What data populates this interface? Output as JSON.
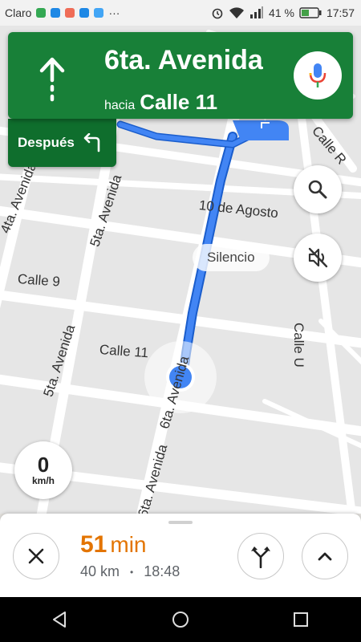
{
  "status_bar": {
    "carrier": "Claro",
    "more": "···",
    "battery_percent": "41 %",
    "time": "17:57",
    "icons": [
      "maps-icon",
      "location-icon",
      "app-icon",
      "bluetooth-icon",
      "message-icon",
      "alarm-icon",
      "wifi-icon",
      "signal-icon",
      "battery-icon"
    ]
  },
  "nav_banner": {
    "street": "6ta. Avenida",
    "toward_label": "hacia",
    "toward_street": "Calle 11",
    "maneuver_icon": "arrow-up-icon",
    "voice_icon": "microphone-icon"
  },
  "then_chip": {
    "label": "Después",
    "icon": "turn-left-icon"
  },
  "map": {
    "streets": [
      "4ta. Avenida",
      "5ta. Avenida",
      "10 de Agosto",
      "Calle 9",
      "Calle 11",
      "5ta. Avenida",
      "6ta. Avenida",
      "6ta. Avenida",
      "Calle U",
      "Calle R"
    ],
    "silence_label": "Silencio",
    "search_icon": "search-icon",
    "mute_icon": "volume-off-icon"
  },
  "speedometer": {
    "value": "0",
    "unit": "km/h"
  },
  "bottom_sheet": {
    "eta_value": "51",
    "eta_unit": "min",
    "distance": "40 km",
    "separator": "•",
    "arrival": "18:48",
    "close_icon": "close-icon",
    "routes_icon": "alt-routes-icon",
    "expand_icon": "chevron-up-icon"
  },
  "system_nav": {
    "back_icon": "back-icon",
    "home_icon": "home-icon",
    "recents_icon": "recents-icon"
  },
  "colors": {
    "banner_green": "#188038",
    "then_green": "#0f6e2d",
    "route_blue": "#4285f4",
    "eta_orange": "#e37400"
  }
}
